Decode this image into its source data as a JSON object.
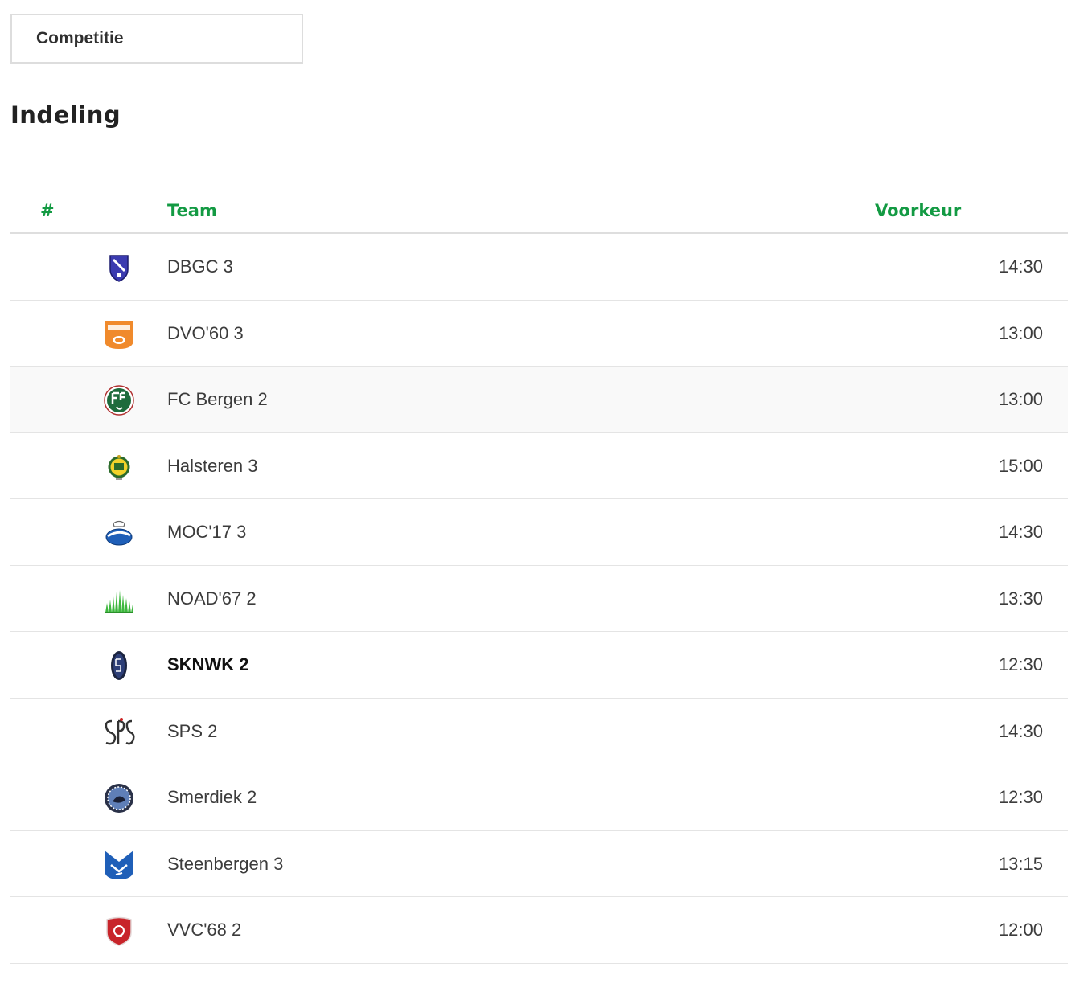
{
  "competition_tab": {
    "label": "Competitie"
  },
  "page_title": "Indeling",
  "table": {
    "columns": {
      "rank": "#",
      "team": "Team",
      "preference": "Voorkeur"
    },
    "rows": [
      {
        "team": "DBGC 3",
        "time": "14:30",
        "logo": "dbgc-logo",
        "bold": false
      },
      {
        "team": "DVO'60 3",
        "time": "13:00",
        "logo": "dvo60-logo",
        "bold": false
      },
      {
        "team": "FC Bergen 2",
        "time": "13:00",
        "logo": "fc-bergen-logo",
        "bold": false
      },
      {
        "team": "Halsteren 3",
        "time": "15:00",
        "logo": "halsteren-logo",
        "bold": false
      },
      {
        "team": "MOC'17 3",
        "time": "14:30",
        "logo": "moc17-logo",
        "bold": false
      },
      {
        "team": "NOAD'67 2",
        "time": "13:30",
        "logo": "noad67-logo",
        "bold": false
      },
      {
        "team": "SKNWK 2",
        "time": "12:30",
        "logo": "sknwk-logo",
        "bold": true
      },
      {
        "team": "SPS 2",
        "time": "14:30",
        "logo": "sps-logo",
        "bold": false
      },
      {
        "team": "Smerdiek 2",
        "time": "12:30",
        "logo": "smerdiek-logo",
        "bold": false
      },
      {
        "team": "Steenbergen 3",
        "time": "13:15",
        "logo": "steenbergen-logo",
        "bold": false
      },
      {
        "team": "VVC'68 2",
        "time": "12:00",
        "logo": "vvc68-logo",
        "bold": false
      }
    ]
  },
  "colors": {
    "accent_green": "#139a43",
    "row_border": "#e4e4e4",
    "header_border": "#dedede"
  }
}
